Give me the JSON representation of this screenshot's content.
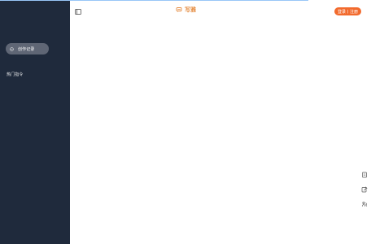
{
  "sidebar": {
    "new_chat_button": "创作记录",
    "section_label": "热门指令"
  },
  "header": {
    "logo_text": "写雅",
    "login_button": "登录丨注册"
  },
  "icons": {
    "menu": "menu-toggle-icon",
    "logo": "chat-logo-icon",
    "new_chat": "message-icon",
    "document": "document-icon",
    "edit": "edit-icon",
    "users": "users-icon"
  },
  "colors": {
    "sidebar_background": "#1f2a3c",
    "accent_orange": "#f26a2d",
    "logo_orange": "#e58b3f",
    "top_progress": "#98c6f7"
  }
}
